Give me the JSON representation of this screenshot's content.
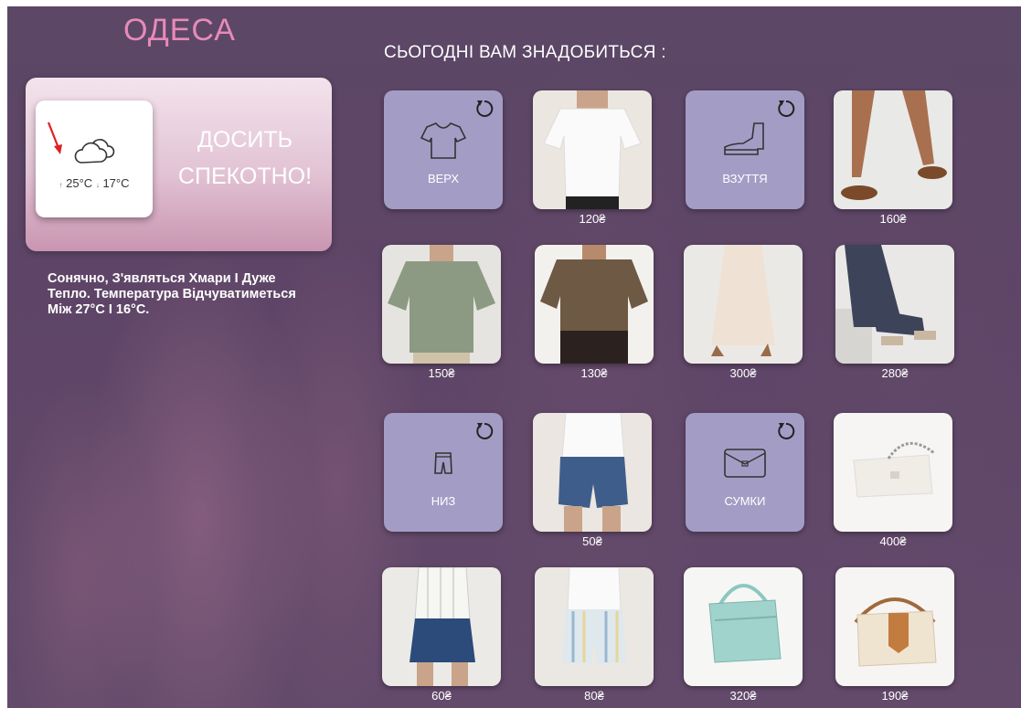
{
  "weather": {
    "city": "ОДЕСА",
    "temp_high": "25°C",
    "temp_low": "17°C",
    "headline_line1": "ДОСИТЬ",
    "headline_line2": "СПЕКОТНО!",
    "description": "Сонячно, З'являться Хмари І Дуже Тепло. Температура Відчуватиметься Між 27°C І 16°C."
  },
  "section_title": "СЬОГОДНІ ВАМ ЗНАДОБИТЬСЯ :",
  "categories": [
    {
      "label": "ВЕРХ",
      "icon": "tshirt-icon"
    },
    {
      "label": "ВЗУТТЯ",
      "icon": "boot-icon"
    },
    {
      "label": "НИЗ",
      "icon": "shorts-icon"
    },
    {
      "label": "СУМКИ",
      "icon": "bag-icon"
    }
  ],
  "items": [
    {
      "price": "120₴",
      "desc": "white t-shirt"
    },
    {
      "price": "160₴",
      "desc": "brown sandals"
    },
    {
      "price": "150₴",
      "desc": "green oversized t-shirt"
    },
    {
      "price": "130₴",
      "desc": "brown t-shirt"
    },
    {
      "price": "300₴",
      "desc": "beige maxi skirt"
    },
    {
      "price": "280₴",
      "desc": "dark tiered skirt"
    },
    {
      "price": "50₴",
      "desc": "denim shorts"
    },
    {
      "price": "400₴",
      "desc": "white crossbody bag"
    },
    {
      "price": "60₴",
      "desc": "denim mini skirt"
    },
    {
      "price": "80₴",
      "desc": "striped shorts"
    },
    {
      "price": "320₴",
      "desc": "mint crossbody bag"
    },
    {
      "price": "190₴",
      "desc": "cream saddle bag"
    }
  ],
  "colors": {
    "accent_pink": "#e88ab8",
    "category_tile": "#a39dc5",
    "background": "#5e4567"
  }
}
